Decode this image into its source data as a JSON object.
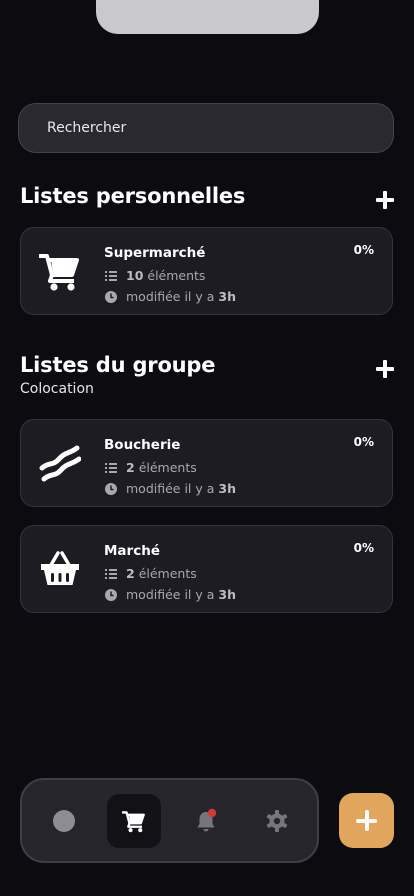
{
  "search": {
    "placeholder": "Rechercher",
    "value": ""
  },
  "personal": {
    "title": "Listes personnelles",
    "lists": [
      {
        "name": "Supermarché",
        "icon": "shopping-cart-icon",
        "count": "10",
        "count_label": "éléments",
        "modified_prefix": "modifiée il y a",
        "modified_value": "3h",
        "progress": "0%"
      }
    ]
  },
  "group": {
    "title": "Listes du groupe",
    "subtitle": "Colocation",
    "lists": [
      {
        "name": "Boucherie",
        "icon": "bacon-icon",
        "count": "2",
        "count_label": "éléments",
        "modified_prefix": "modifiée il y a",
        "modified_value": "3h",
        "progress": "0%"
      },
      {
        "name": "Marché",
        "icon": "basket-icon",
        "count": "2",
        "count_label": "éléments",
        "modified_prefix": "modifiée il y a",
        "modified_value": "3h",
        "progress": "0%"
      }
    ]
  },
  "tabbar": {
    "tabs": [
      {
        "name": "profile",
        "icon": "avatar-icon"
      },
      {
        "name": "lists",
        "icon": "shopping-cart-icon",
        "active": true
      },
      {
        "name": "notifications",
        "icon": "bell-icon",
        "badge": true
      },
      {
        "name": "settings",
        "icon": "gear-icon"
      }
    ]
  },
  "colors": {
    "background": "#0c0b10",
    "card": "#1d1c22",
    "accent": "#e2a55d",
    "badge": "#d03a3a"
  }
}
